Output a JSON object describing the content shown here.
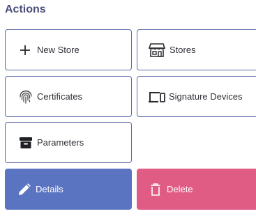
{
  "section": {
    "title": "Actions"
  },
  "actions": {
    "new_store": {
      "label": "New Store",
      "icon": "plus-icon"
    },
    "stores": {
      "label": "Stores",
      "icon": "store-icon"
    },
    "certificates": {
      "label": "Certificates",
      "icon": "fingerprint-icon"
    },
    "signature_devices": {
      "label": "Signature Devices",
      "icon": "devices-icon"
    },
    "parameters": {
      "label": "Parameters",
      "icon": "archive-icon"
    },
    "details": {
      "label": "Details",
      "icon": "pencil-icon"
    },
    "delete": {
      "label": "Delete",
      "icon": "trash-icon"
    }
  },
  "colors": {
    "title": "#4a4f7a",
    "card_border": "#5d6aa6",
    "details_bg": "#5b74c2",
    "delete_bg": "#e05c85"
  }
}
